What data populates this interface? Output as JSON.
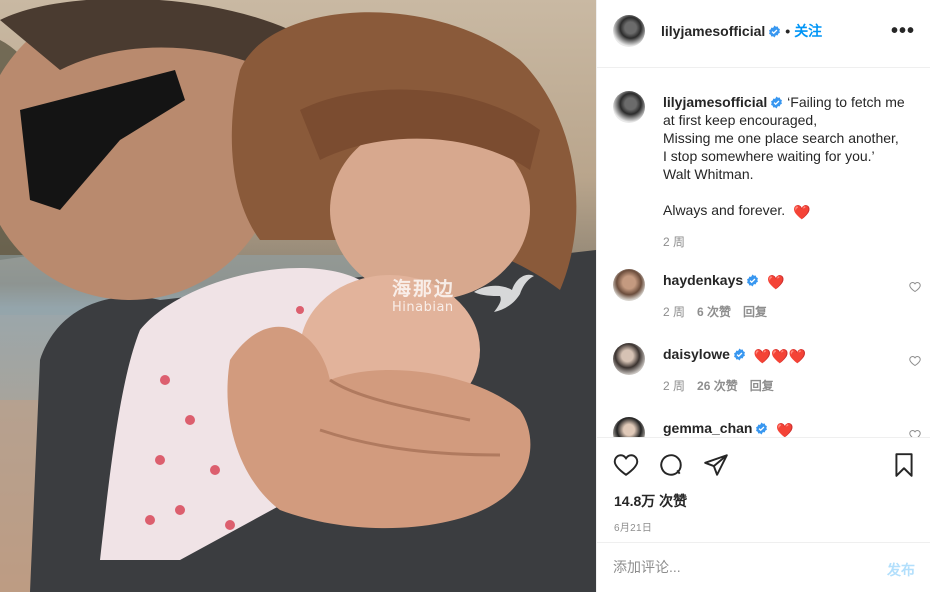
{
  "post": {
    "owner": "lilyjamesofficial",
    "follow_label": "关注",
    "separator": "•",
    "more_label": "•••",
    "caption": "‘Failing to fetch me at first keep encouraged,\nMissing me one place search another,\nI stop somewhere waiting for you.’\nWalt Whitman.\n\nAlways and forever.",
    "caption_emoji": "❤️",
    "caption_time": "2 周",
    "likes": "14.8万 次赞",
    "date": "6月21日"
  },
  "watermark": {
    "cn": "海那边",
    "en": "Hinabian"
  },
  "comments": [
    {
      "user": "haydenkays",
      "text": "❤️",
      "time": "2 周",
      "likes": "6 次赞",
      "reply": "回复"
    },
    {
      "user": "daisylowe",
      "text": "❤️❤️❤️",
      "time": "2 周",
      "likes": "26 次赞",
      "reply": "回复"
    },
    {
      "user": "gemma_chan",
      "text": "❤️"
    }
  ],
  "add_comment": {
    "placeholder": "添加评论...",
    "post_label": "发布"
  },
  "icons": [
    "verified-icon",
    "heart-icon",
    "comment-icon",
    "share-icon",
    "bookmark-icon",
    "more-icon"
  ],
  "colors": {
    "accent": "#0095f6",
    "verified": "#3897f0",
    "post_disabled": "#b2dffc",
    "secondary_text": "#8e8e8e",
    "heart_emoji": "#e0245e"
  }
}
